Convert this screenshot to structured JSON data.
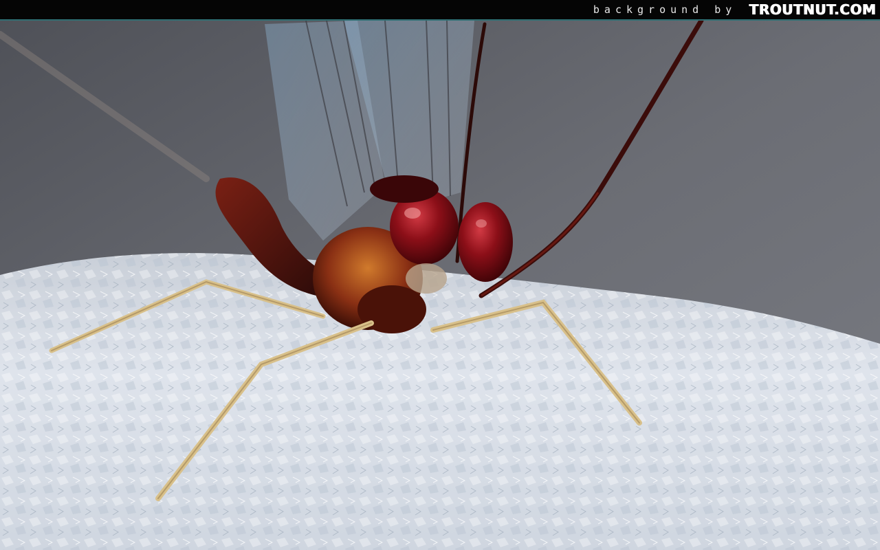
{
  "credit": {
    "prefix": "background by",
    "brand": "TROUTNUT.COM"
  },
  "photo": {
    "subject": "mayfly-on-snow",
    "icon": "mayfly-photo"
  },
  "colors": {
    "bar": "#050505",
    "bar_border": "#2f6f73",
    "background_gray": "#5e6068",
    "snow": "#d7dde6",
    "eye_red": "#8c0f18",
    "body_brown": "#6a1d12",
    "leg_tan": "#d8c08a"
  }
}
